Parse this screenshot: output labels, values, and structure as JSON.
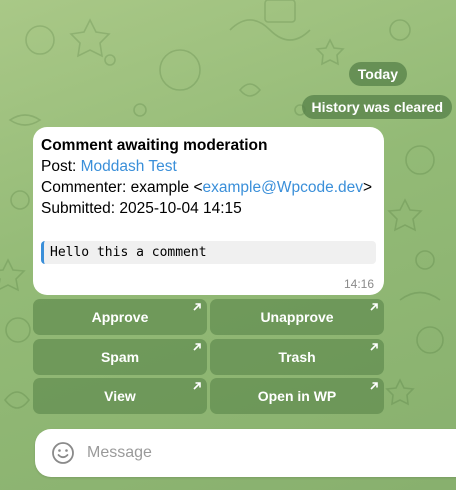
{
  "chat": {
    "date_chip": "Today",
    "service_message": "History was cleared"
  },
  "message": {
    "title": "Comment awaiting moderation",
    "post_label": "Post: ",
    "post_link": "Moddash Test",
    "commenter_label": "Commenter: example <",
    "commenter_email": "example@Wpcode.dev",
    "commenter_suffix": ">",
    "submitted": "Submitted: 2025-10-04 14:15",
    "comment_text": "Hello this a comment",
    "time": "14:16"
  },
  "buttons": {
    "approve": "Approve",
    "unapprove": "Unapprove",
    "spam": "Spam",
    "trash": "Trash",
    "view": "View",
    "open_in_wp": "Open in WP"
  },
  "composer": {
    "placeholder": "Message",
    "emoji_icon": "smile-icon"
  },
  "colors": {
    "link": "#3a8fd9",
    "button_bg": "#5a864a",
    "background": "#93ba76"
  }
}
